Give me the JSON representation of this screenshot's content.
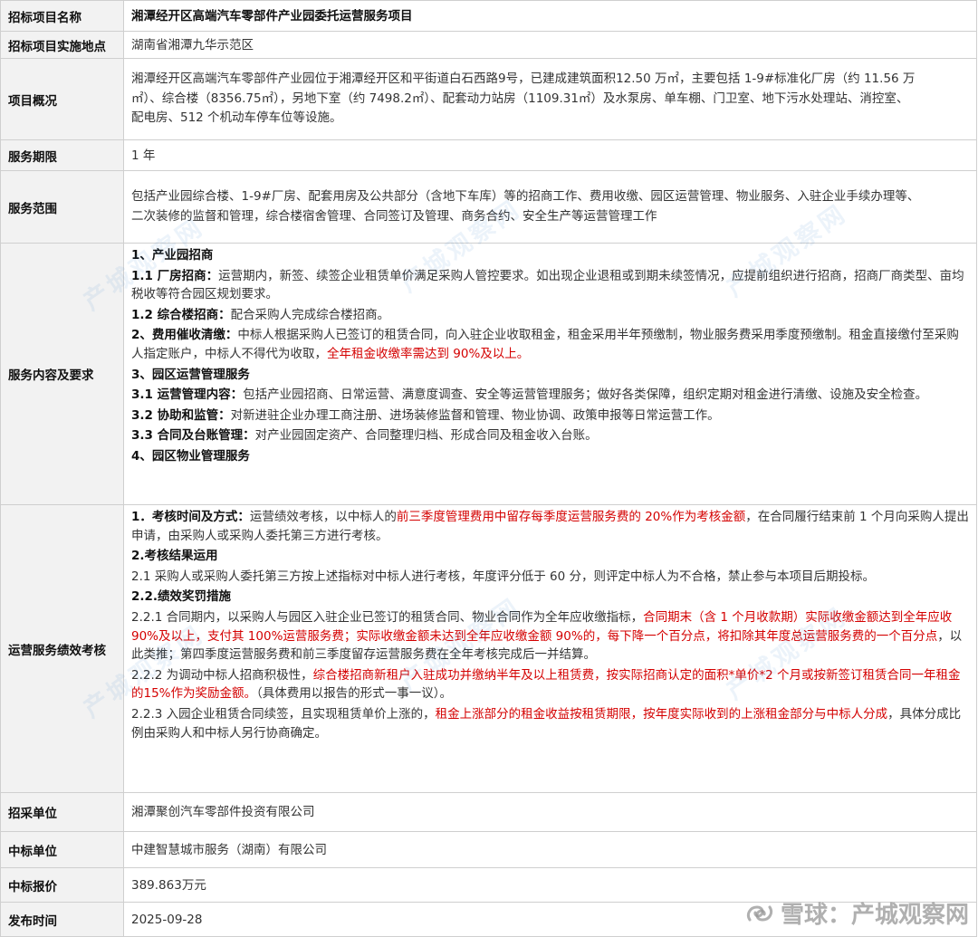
{
  "table": {
    "project_name": {
      "label": "招标项目名称",
      "value": "湘潭经开区高端汽车零部件产业园委托运营服务项目"
    },
    "location": {
      "label": "招标项目实施地点",
      "value": "湖南省湘潭九华示范区"
    },
    "overview": {
      "label": "项目概况",
      "lines": [
        "湘潭经开区高端汽车零部件产业园位于湘潭经开区和平街道白石西路9号，已建成建筑面积12.50 万㎡，主要包括 1-9#标准化厂房（约 11.56 万",
        "㎡）、综合楼（8356.75㎡），另地下室（约 7498.2㎡）、配套动力站房（1109.31㎡）及水泵房、单车棚、门卫室、地下污水处理站、消控室、",
        "配电房、512 个机动车停车位等设施。"
      ]
    },
    "period": {
      "label": "服务期限",
      "value": "1 年"
    },
    "scope": {
      "label": "服务范围",
      "lines": [
        "包括产业园综合楼、1-9#厂房、配套用房及公共部分（含地下车库）等的招商工作、费用收缴、园区运营管理、物业服务、入驻企业手续办理等、",
        "二次装修的监督和管理，综合楼宿舍管理、合同签订及管理、商务合约、安全生产等运营管理工作"
      ]
    },
    "content": {
      "label": "服务内容及要求",
      "s1": "1、产业园招商",
      "s1_1_h": "1.1 厂房招商：",
      "s1_1_t": "运营期内，新签、续签企业租赁单价满足采购人管控要求。如出现企业退租或到期未续签情况，应提前组织进行招商，招商厂商类型、亩均税收等符合园区规划要求。",
      "s1_2_h": "1.2 综合楼招商：",
      "s1_2_t": "配合采购人完成综合楼招商。",
      "s2_h": "2、费用催收清缴：",
      "s2_t": "中标人根据采购人已签订的租赁合同，向入驻企业收取租金，租金采用半年预缴制，物业服务费采用季度预缴制。租金直接缴付至采购人指定账户，中标人不得代为收取，",
      "s2_red": "全年租金收缴率需达到 90%及以上。",
      "s3": "3、园区运营管理服务",
      "s3_1_h": "3.1 运营管理内容：",
      "s3_1_t": "包括产业园招商、日常运营、满意度调查、安全等运营管理服务；做好各类保障，组织定期对租金进行清缴、设施及安全检查。",
      "s3_2_h": "3.2 协助和监管：",
      "s3_2_t": "对新进驻企业办理工商注册、进场装修监督和管理、物业协调、政策申报等日常运营工作。",
      "s3_3_h": "3.3 合同及台账管理：",
      "s3_3_t": "对产业园固定资产、合同整理归档、形成合同及租金收入台账。",
      "s4": "4、园区物业管理服务"
    },
    "assessment": {
      "label": "运营服务绩效考核",
      "p1_h": "1．考核时间及方式：",
      "p1_a": "运营绩效考核，以中标人的",
      "p1_red": "前三季度管理费用中留存每季度运营服务费的 20%作为考核金额",
      "p1_b": "，在合同履行结束前 1 个月向采购人提出申请，由采购人或采购人委托第三方进行考核。",
      "p2_h": "2.考核结果运用",
      "p2_1": "2.1 采购人或采购人委托第三方按上述指标对中标人进行考核，年度评分低于 60 分，则评定中标人为不合格，禁止参与本项目后期投标。",
      "p2_2_h": "2.2.绩效奖罚措施",
      "p2_2_1_a": "2.2.1 合同期内，以采购人与园区入驻企业已签订的租赁合同、物业合同作为全年应收缴指标，",
      "p2_2_1_red": "合同期末（含 1 个月收款期）实际收缴金额达到全年应收 90%及以上，支付其 100%运营服务费；实际收缴金额未达到全年应收缴金额 90%的，每下降一个百分点，将扣除其年度总运营服务费的一个百分点",
      "p2_2_1_b": "，以此类推；第四季度运营服务费和前三季度留存运营服务费在全年考核完成后一并结算。",
      "p2_2_2_a": "2.2.2 为调动中标人招商积极性，",
      "p2_2_2_red": "综合楼招商新租户入驻成功并缴纳半年及以上租赁费，按实际招商认定的面积*单价*2 个月或按新签订租赁合同一年租金的15%作为奖励金额。",
      "p2_2_2_b": "（具体费用以报告的形式一事一议）。",
      "p2_2_3_a": "2.2.3 入园企业租赁合同续签，且实现租赁单价上涨的，",
      "p2_2_3_red": "租金上涨部分的租金收益按租赁期限，按年度实际收到的上涨租金部分与中标人分成",
      "p2_2_3_b": "，具体分成比例由采购人和中标人另行协商确定。"
    },
    "purchaser": {
      "label": "招采单位",
      "value": "湘潭聚创汽车零部件投资有限公司"
    },
    "winner": {
      "label": "中标单位",
      "value": "中建智慧城市服务（湖南）有限公司"
    },
    "price": {
      "label": "中标报价",
      "value": "389.863万元"
    },
    "date": {
      "label": "发布时间",
      "value": "2025-09-28"
    }
  },
  "watermark": {
    "text": "产城观察网"
  },
  "brand": {
    "text": "雪球：产城观察网"
  },
  "colors": {
    "label_bg": "#f2f2f2",
    "border": "#cfcfcf",
    "highlight": "#d40000"
  }
}
